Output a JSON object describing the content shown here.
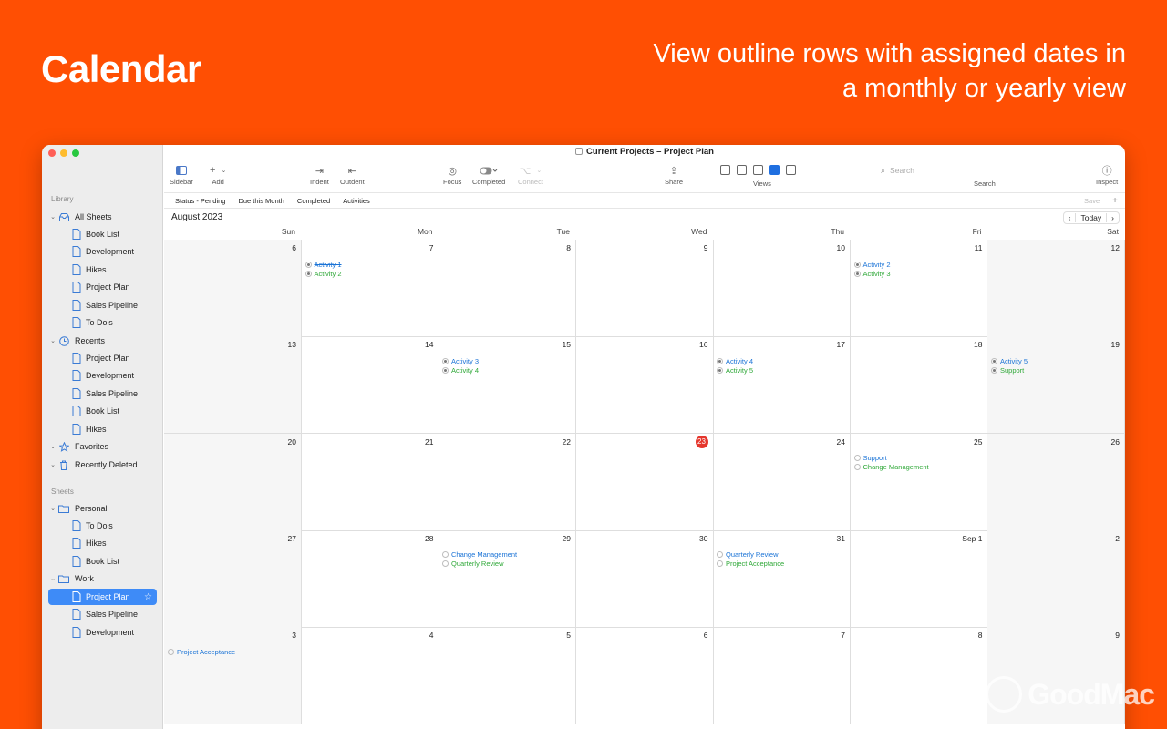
{
  "hero": {
    "title": "Calendar",
    "tagline": "View outline rows with assigned dates in a monthly or yearly view"
  },
  "window": {
    "title": "Current Projects – Project Plan"
  },
  "sidebar": {
    "library_label": "Library",
    "sheets_label": "Sheets",
    "all_sheets": "All Sheets",
    "all_sheets_items": [
      "Book List",
      "Development",
      "Hikes",
      "Project Plan",
      "Sales Pipeline",
      "To Do's"
    ],
    "recents": "Recents",
    "recents_items": [
      "Project Plan",
      "Development",
      "Sales Pipeline",
      "Book List",
      "Hikes"
    ],
    "favorites": "Favorites",
    "recently_deleted": "Recently Deleted",
    "personal": "Personal",
    "personal_items": [
      "To Do's",
      "Hikes",
      "Book List"
    ],
    "work": "Work",
    "work_items": [
      "Project Plan",
      "Sales Pipeline",
      "Development"
    ]
  },
  "toolbar": {
    "sidebar": "Sidebar",
    "add": "Add",
    "indent": "Indent",
    "outdent": "Outdent",
    "focus": "Focus",
    "completed": "Completed",
    "connect": "Connect",
    "share": "Share",
    "views": "Views",
    "search_label": "Search",
    "search_placeholder": "Search",
    "inspect": "Inspect"
  },
  "filters": {
    "items": [
      "Status - Pending",
      "Due this Month",
      "Completed",
      "Activities"
    ],
    "save": "Save",
    "plus": "+"
  },
  "calendar": {
    "month": "August 2023",
    "today_button": "Today",
    "prev": "‹",
    "next": "›",
    "weekdays": [
      "Sun",
      "Mon",
      "Tue",
      "Wed",
      "Thu",
      "Fri",
      "Sat"
    ],
    "weeks": [
      [
        {
          "day": "6",
          "events": []
        },
        {
          "day": "7",
          "events": [
            {
              "label": "Activity 1",
              "color": "blue",
              "done": true
            },
            {
              "label": "Activity 2",
              "color": "green",
              "done": false
            }
          ]
        },
        {
          "day": "8",
          "events": []
        },
        {
          "day": "9",
          "events": []
        },
        {
          "day": "10",
          "events": []
        },
        {
          "day": "11",
          "events": [
            {
              "label": "Activity 2",
              "color": "blue",
              "done": false
            },
            {
              "label": "Activity 3",
              "color": "green",
              "done": false
            }
          ]
        },
        {
          "day": "12",
          "events": []
        }
      ],
      [
        {
          "day": "13",
          "events": []
        },
        {
          "day": "14",
          "events": []
        },
        {
          "day": "15",
          "events": [
            {
              "label": "Activity 3",
              "color": "blue",
              "done": false
            },
            {
              "label": "Activity 4",
              "color": "green",
              "done": false
            }
          ]
        },
        {
          "day": "16",
          "events": []
        },
        {
          "day": "17",
          "events": [
            {
              "label": "Activity 4",
              "color": "blue",
              "done": false
            },
            {
              "label": "Activity 5",
              "color": "green",
              "done": false
            }
          ]
        },
        {
          "day": "18",
          "events": []
        },
        {
          "day": "19",
          "events": [
            {
              "label": "Activity 5",
              "color": "blue",
              "done": false
            },
            {
              "label": "Support",
              "color": "green",
              "done": false
            }
          ]
        }
      ],
      [
        {
          "day": "20",
          "events": []
        },
        {
          "day": "21",
          "events": []
        },
        {
          "day": "22",
          "events": []
        },
        {
          "day": "23",
          "today": true,
          "events": []
        },
        {
          "day": "24",
          "events": []
        },
        {
          "day": "25",
          "events": [
            {
              "label": "Support",
              "color": "blue",
              "done": false
            },
            {
              "label": "Change Management",
              "color": "green",
              "done": false
            }
          ]
        },
        {
          "day": "26",
          "events": []
        }
      ],
      [
        {
          "day": "27",
          "events": []
        },
        {
          "day": "28",
          "events": []
        },
        {
          "day": "29",
          "events": [
            {
              "label": "Change Management",
              "color": "blue",
              "done": false
            },
            {
              "label": "Quarterly Review",
              "color": "green",
              "done": false
            }
          ]
        },
        {
          "day": "30",
          "events": []
        },
        {
          "day": "31",
          "events": [
            {
              "label": "Quarterly Review",
              "color": "blue",
              "done": false
            },
            {
              "label": "Project Acceptance",
              "color": "green",
              "done": false
            }
          ]
        },
        {
          "day": "Sep 1",
          "events": []
        },
        {
          "day": "2",
          "events": []
        }
      ],
      [
        {
          "day": "3",
          "events": [
            {
              "label": "Project Acceptance",
              "color": "blue",
              "done": false
            }
          ]
        },
        {
          "day": "4",
          "events": []
        },
        {
          "day": "5",
          "events": []
        },
        {
          "day": "6",
          "events": []
        },
        {
          "day": "7",
          "events": []
        },
        {
          "day": "8",
          "events": []
        },
        {
          "day": "9",
          "events": []
        }
      ]
    ]
  },
  "watermark": "GoodMac",
  "colors": {
    "background": "#FF4F03",
    "selection": "#3E8BF7",
    "today": "#E5362C",
    "event_blue": "#1a73d6",
    "event_green": "#2fa838"
  }
}
